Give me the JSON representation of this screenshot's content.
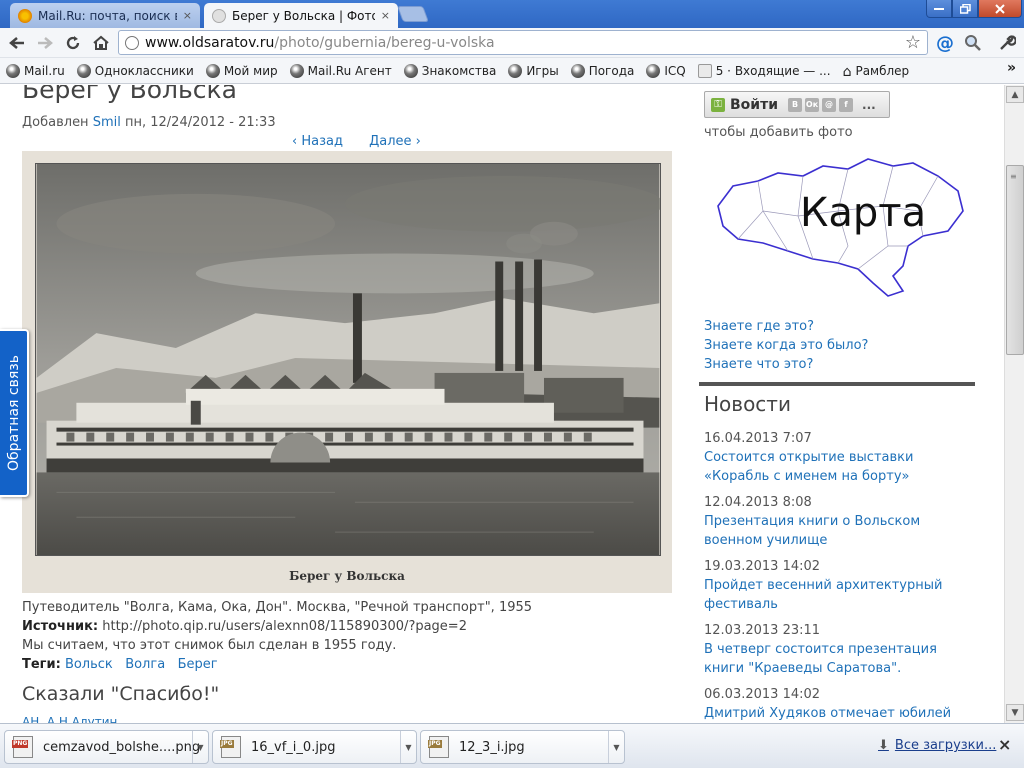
{
  "browser": {
    "tabs": [
      {
        "title": "Mail.Ru: почта, поиск в и",
        "active": false
      },
      {
        "title": "Берег у Вольска | Фотогр",
        "active": true
      }
    ],
    "close_glyph": "×",
    "url_host": "www.oldsaratov.ru",
    "url_path": "/photo/gubernia/bereg-u-volska",
    "bookmarks": [
      {
        "label": "Mail.ru",
        "icon": "globe-icon"
      },
      {
        "label": "Одноклассники",
        "icon": "globe-icon"
      },
      {
        "label": "Мой мир",
        "icon": "globe-icon"
      },
      {
        "label": "Mail.Ru Агент",
        "icon": "globe-icon"
      },
      {
        "label": "Знакомства",
        "icon": "globe-icon"
      },
      {
        "label": "Игры",
        "icon": "globe-icon"
      },
      {
        "label": "Погода",
        "icon": "globe-icon"
      },
      {
        "label": "ICQ",
        "icon": "globe-icon"
      },
      {
        "label": "5 · Входящие — ...",
        "icon": "mail-icon"
      },
      {
        "label": "Рамблер",
        "icon": "home-icon"
      }
    ],
    "bookmarks_more": "»"
  },
  "page": {
    "title": "Берег у Вольска",
    "meta_prefix": "Добавлен",
    "author": "Smil",
    "meta_date": "пн, 12/24/2012 - 21:33",
    "pager_prev": "‹ Назад",
    "pager_next": "Далее ›",
    "photo_caption": "Берег у Вольска",
    "description": "Путеводитель \"Волга, Кама, Ока, Дон\". Москва, \"Речной транспорт\", 1955",
    "source_label": "Источник:",
    "source_url": "http://photo.qip.ru/users/alexnn08/115890300/?page=2",
    "year_note": "Мы считаем, что этот снимок был сделан в 1955 году.",
    "tags_label": "Теги:",
    "tags": [
      "Вольск",
      "Волга",
      "Берег"
    ],
    "thanks_title": "Сказали \"Спасибо!\"",
    "thanks_names": "АН,  А.Н.Алутин"
  },
  "sidebar": {
    "login_label": "Войти",
    "social": [
      "В",
      "Ок",
      "@",
      "f"
    ],
    "social_more": "...",
    "login_hint": "чтобы добавить фото",
    "map_label": "Карта",
    "links": [
      "Знаете где это?",
      "Знаете когда это было?",
      "Знаете что это?"
    ],
    "news_title": "Новости",
    "news": [
      {
        "date": "16.04.2013 7:07",
        "text": "Состоится открытие выставки «Корабль с именем на борту»"
      },
      {
        "date": "12.04.2013 8:08",
        "text": "Презентация книги о Вольском военном училище"
      },
      {
        "date": "19.03.2013 14:02",
        "text": "Пройдет весенний архитектурный фестиваль"
      },
      {
        "date": "12.03.2013 23:11",
        "text": "В четверг состоится презентация книги \"Краеведы Саратова\"."
      },
      {
        "date": "06.03.2013 14:02",
        "text": "Дмитрий Худяков отмечает юбилей"
      }
    ]
  },
  "feedback": {
    "label": "Обратная связь"
  },
  "downloads": {
    "items": [
      {
        "name": "cemzavod_bolshe....png",
        "type": "PNG"
      },
      {
        "name": "16_vf_i_0.jpg",
        "type": "JPG"
      },
      {
        "name": "12_3_i.jpg",
        "type": "JPG"
      }
    ],
    "all_label": "Все загрузки..."
  }
}
